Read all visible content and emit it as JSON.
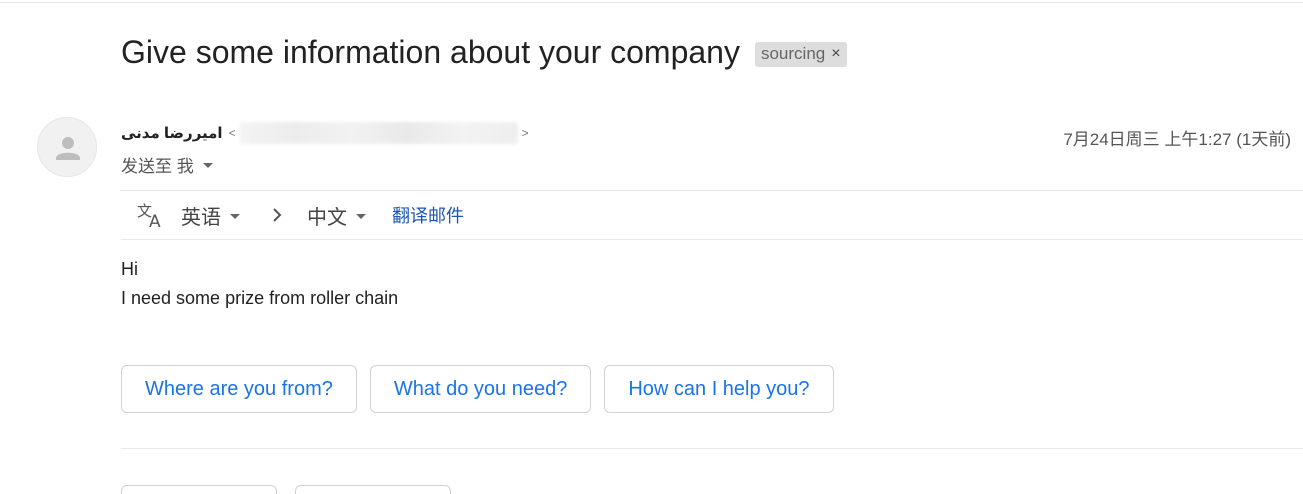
{
  "subject": {
    "title": "Give some information about your company",
    "label": "sourcing",
    "label_remove": "×"
  },
  "sender": {
    "name": "امیررضا مدنی",
    "email_open": "<",
    "email_close": ">",
    "to_label": "发送至 我",
    "date": "7月24日周三 上午1:27 (1天前)"
  },
  "translate": {
    "icon": "translate-icon",
    "from_language": "英语",
    "to_language": "中文",
    "action_link": "翻译邮件"
  },
  "body": {
    "lines": [
      "Hi",
      "I need some prize from roller chain"
    ]
  },
  "smart_replies": [
    "Where are you from?",
    "What do you need?",
    "How can I help you?"
  ],
  "colors": {
    "link_blue": "#1a73e8",
    "translate_link": "#1a56b4",
    "chip_bg": "#dddddd"
  }
}
